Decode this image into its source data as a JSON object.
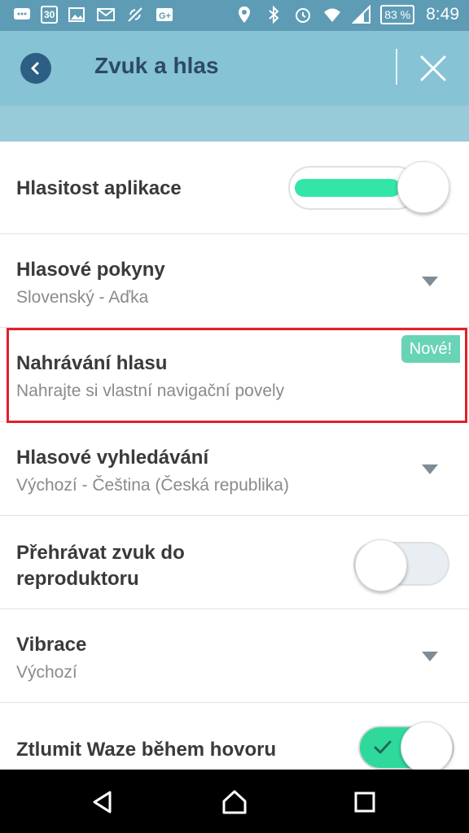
{
  "status_bar": {
    "date_badge": "30",
    "battery": "83 %",
    "time": "8:49",
    "icons": [
      "message-icon",
      "calendar-icon",
      "image-icon",
      "gmail-icon",
      "wireless-icon",
      "google-plus-icon",
      "location-icon",
      "bluetooth-icon",
      "alarm-icon",
      "wifi-icon",
      "signal-icon"
    ]
  },
  "header": {
    "title": "Zvuk a hlas"
  },
  "settings": [
    {
      "title": "Hlasitost aplikace",
      "control": "slider",
      "value_percent": 100
    },
    {
      "title": "Hlasové pokyny",
      "subtitle": "Slovenský - Aďka",
      "control": "dropdown"
    },
    {
      "title": "Nahrávání hlasu",
      "subtitle": "Nahrajte si vlastní navigační povely",
      "badge": "Nové!"
    },
    {
      "title": "Hlasové vyhledávání",
      "subtitle": "Výchozí - Čeština (Česká republika)",
      "control": "dropdown"
    },
    {
      "title": "Přehrávat zvuk do reproduktoru",
      "control": "toggle",
      "on": false
    },
    {
      "title": "Vibrace",
      "subtitle": "Výchozí",
      "control": "dropdown"
    },
    {
      "title": "Ztlumit Waze během hovoru",
      "control": "toggle",
      "on": true
    }
  ],
  "colors": {
    "status_bar": "#5e9cb5",
    "header": "#86c3d5",
    "accent_green": "#33e6a7",
    "highlight_red": "#e1202b"
  }
}
